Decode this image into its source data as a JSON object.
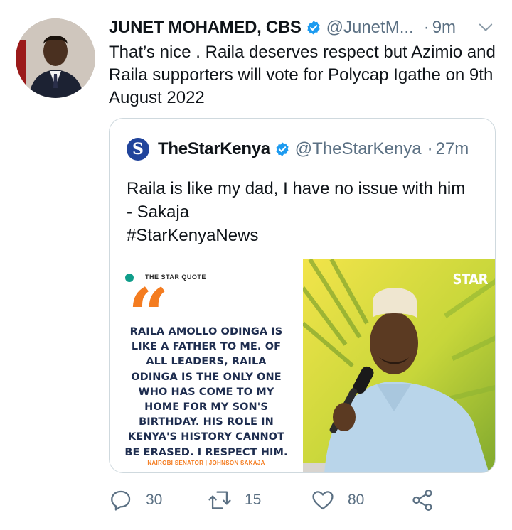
{
  "tweet": {
    "author_name": "JUNET MOHAMED, CBS",
    "handle": "@JunetM...",
    "separator": "·",
    "time": "9m",
    "text": "That’s nice . Raila deserves respect but Azimio and Raila supporters will vote for Polycap Igathe on 9th August 2022"
  },
  "quoted": {
    "logo_letter": "S",
    "author_name": "TheStarKenya",
    "handle": "@TheStarKenya",
    "separator": "·",
    "time": "27m",
    "text_line1": "Raila is like my dad, I have no issue with him",
    "text_line2": "- Sakaja",
    "text_line3": "#StarKenyaNews",
    "media": {
      "label": "THE STAR QUOTE",
      "quote_mark": "“",
      "quote": "RAILA AMOLLO ODINGA IS LIKE A FATHER TO ME. OF ALL LEADERS, RAILA ODINGA IS THE ONLY ONE WHO HAS COME TO MY HOME FOR MY SON'S BIRTHDAY. HIS ROLE IN KENYA'S HISTORY CANNOT BE ERASED. I RESPECT HIM.",
      "attribution": "NAIROBI SENATOR | JOHNSON SAKAJA",
      "watermark": "STAR"
    }
  },
  "actions": {
    "reply_count": "30",
    "retweet_count": "15",
    "like_count": "80"
  },
  "icons": {
    "verified": "verified-badge-icon",
    "menu": "chevron-down-icon",
    "reply": "reply-icon",
    "retweet": "retweet-icon",
    "like": "heart-icon",
    "share": "share-icon"
  },
  "colors": {
    "verified_blue": "#1d9bf0",
    "secondary_text": "#5b7083",
    "border": "#cfd9de",
    "quote_orange": "#f47c20",
    "quote_navy": "#1e2d4f"
  }
}
